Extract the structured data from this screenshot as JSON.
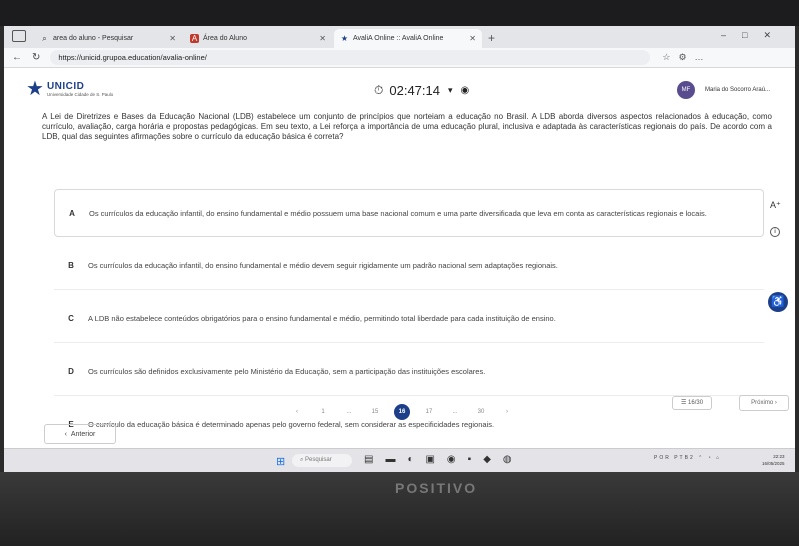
{
  "browser": {
    "tabs": [
      {
        "label": "area do aluno - Pesquisar",
        "icon": "search-icon"
      },
      {
        "label": "Área do Aluno",
        "icon": "app-icon"
      },
      {
        "label": "AvaliA Online :: AvaliA Online",
        "icon": "star-icon"
      }
    ],
    "url": "https://unicid.grupoa.education/avalia-online/"
  },
  "header": {
    "logo_name": "UNICID",
    "logo_sub": "Universidade Cidade de S. Paulo",
    "timer": "02:47:14",
    "avatar_initials": "MF",
    "user_name": "Maria do Socorro Araú..."
  },
  "question": {
    "statement": "A Lei de Diretrizes e Bases da Educação Nacional (LDB) estabelece um conjunto de princípios que norteiam a educação no Brasil. A LDB aborda diversos aspectos relacionados à educação, como currículo, avaliação, carga horária e propostas pedagógicas. Em seu texto, a Lei reforça a importância de uma educação plural, inclusiva e adaptada às características regionais do país. De acordo com a LDB, qual das seguintes afirmações sobre o currículo da educação básica é correta?",
    "options": [
      {
        "letter": "A",
        "text": "Os currículos da educação infantil, do ensino fundamental e médio possuem uma base nacional comum e uma parte diversificada que leva em conta as características regionais e locais."
      },
      {
        "letter": "B",
        "text": "Os currículos da educação infantil, do ensino fundamental e médio devem seguir rigidamente um padrão nacional sem adaptações regionais."
      },
      {
        "letter": "C",
        "text": "A LDB não estabelece conteúdos obrigatórios para o ensino fundamental e médio, permitindo total liberdade para cada instituição de ensino."
      },
      {
        "letter": "D",
        "text": "Os currículos são definidos exclusivamente pelo Ministério da Educação, sem a participação das instituições escolares."
      },
      {
        "letter": "E",
        "text": "O currículo da educação básica é determinado apenas pelo governo federal, sem considerar as especificidades regionais."
      }
    ]
  },
  "pagination": {
    "pages": [
      "1",
      "...",
      "15",
      "16",
      "17",
      "...",
      "30"
    ],
    "current": "16",
    "progress": "16/30",
    "next_label": "Próximo",
    "prev_label": "Anterior"
  },
  "taskbar": {
    "search_placeholder": "Pesquisar",
    "lang": "POR PTB2",
    "time": "22:23",
    "date": "16/05/2025"
  },
  "monitor_brand": "POSITIVO",
  "colors": {
    "accent": "#1d3f8a"
  }
}
